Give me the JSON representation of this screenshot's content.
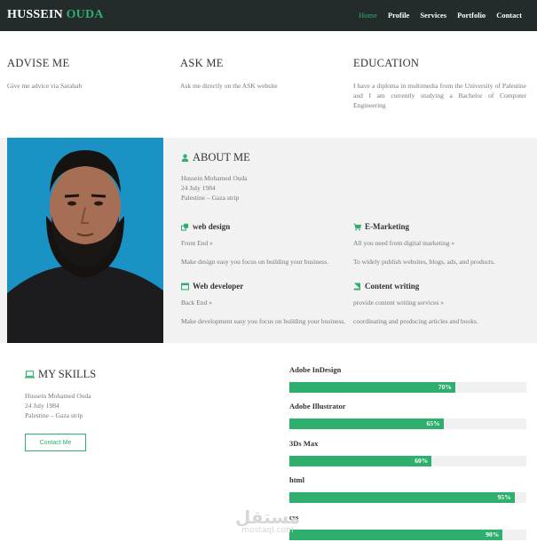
{
  "nav": {
    "brand_first": "HUSSEIN",
    "brand_second": "OUDA",
    "links": [
      "Home",
      "Profile",
      "Services",
      "Portfolio",
      "Contact"
    ]
  },
  "services": [
    {
      "title": "ADVISE ME",
      "text": "Give me advice via Sarahah"
    },
    {
      "title": "ASK ME",
      "text": "Ask me directly on the ASK website"
    },
    {
      "title": "EDUCATION",
      "text": "I have a diploma in multimedia from the University of Palestine and I am currently studying a Bachelor of Computer Engineering"
    }
  ],
  "about": {
    "title": "ABOUT ME",
    "name": "Hussein Mohamed Ouda",
    "dob": "24 July 1984",
    "location": "Palestine – Gaza strip",
    "features": [
      {
        "icon": "window-icon",
        "title": "web design",
        "sub": "Front End »",
        "desc": "Make design easy you focus on building your business."
      },
      {
        "icon": "cart-icon",
        "title": "E-Marketing",
        "sub": "All you need from digital marketing »",
        "desc": "To widely publish websites, blogs, ads, and products."
      },
      {
        "icon": "browser-icon",
        "title": "Web developer",
        "sub": "Back End »",
        "desc": "Make development easy you focus on building your business."
      },
      {
        "icon": "book-icon",
        "title": "Content writing",
        "sub": "provide content writing services »",
        "desc": "coordinating and producing articles and books."
      }
    ]
  },
  "skills": {
    "title": "MY SKILLS",
    "name": "Hussein Mohamed Ouda",
    "dob": "24 July 1984",
    "location": "Palestine – Gaza strip",
    "contact_label": "Contact Me",
    "items": [
      {
        "name": "Adobe InDesign",
        "percent": 70,
        "label": "70%"
      },
      {
        "name": "Adobe Illustrator",
        "percent": 65,
        "label": "65%"
      },
      {
        "name": "3Ds Max",
        "percent": 60,
        "label": "60%"
      },
      {
        "name": "html",
        "percent": 95,
        "label": "95%"
      },
      {
        "name": "css",
        "percent": 90,
        "label": "90%"
      }
    ]
  },
  "watermark": {
    "arabic": "مستقل",
    "latin": "mostaql.com"
  },
  "colors": {
    "accent": "#2eaf6e",
    "navbar": "#232b2b",
    "photo_bg": "#1a93c4"
  }
}
